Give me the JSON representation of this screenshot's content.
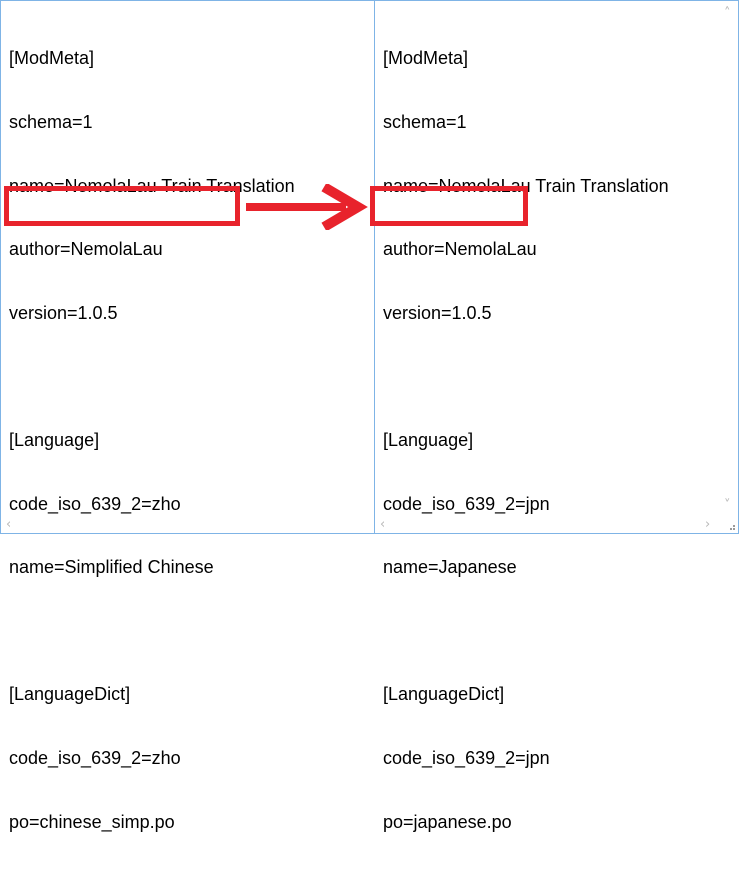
{
  "left_pane": {
    "lines": [
      "[ModMeta]",
      "schema=1",
      "name=NemolaLau Train Translation",
      "author=NemolaLau",
      "version=1.0.5",
      "",
      "[Language]",
      "code_iso_639_2=zho",
      "name=Simplified Chinese",
      "",
      "[LanguageDict]",
      "code_iso_639_2=zho",
      "po=chinese_simp.po"
    ]
  },
  "right_pane": {
    "lines": [
      "[ModMeta]",
      "schema=1",
      "name=NemolaLau Train Translation",
      "author=NemolaLau",
      "version=1.0.5",
      "",
      "[Language]",
      "code_iso_639_2=jpn",
      "name=Japanese",
      "",
      "[LanguageDict]",
      "code_iso_639_2=jpn",
      "po=japanese.po"
    ]
  },
  "colors": {
    "highlight": "#e8232c",
    "pane_border": "#7fb4e6",
    "scroll_arrow": "#b8b8b8"
  },
  "icons": {
    "arrow": "right-arrow-icon",
    "scroll_up": "chevron-up-icon",
    "scroll_down": "chevron-down-icon",
    "scroll_left": "chevron-left-icon",
    "scroll_right": "chevron-right-icon",
    "resize_grip": "resize-grip-icon"
  }
}
